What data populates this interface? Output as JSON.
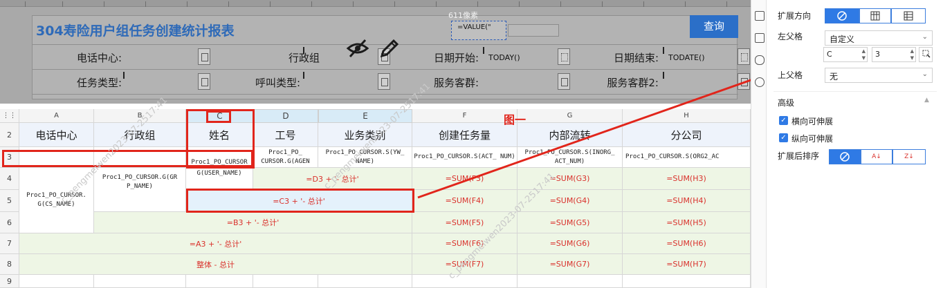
{
  "report": {
    "title": "304寿险用户组任务创建统计报表",
    "pixel_label": "611像素",
    "value_formula": "=VALUE(\"",
    "query_button": "查询",
    "fields": {
      "call_center": "电话中心:",
      "admin_group": "行政组",
      "date_start": "日期开始:",
      "date_start_value": "TODAY()",
      "date_end": "日期结束:",
      "date_end_value": "TODATE()",
      "task_type": "任务类型:",
      "call_type": "呼叫类型:",
      "service_group": "服务客群:",
      "service_group2": "服务客群2:"
    }
  },
  "sheet": {
    "columns": [
      "A",
      "B",
      "C",
      "D",
      "E",
      "F",
      "G",
      "H"
    ],
    "rows": [
      "2",
      "3",
      "4",
      "5",
      "6",
      "7",
      "8",
      "9"
    ],
    "headers": [
      "电话中心",
      "行政组",
      "姓名",
      "工号",
      "业务类别",
      "创建任务量",
      "内部流转",
      "分公司"
    ],
    "row3": {
      "C": "Proc1_PO_CURSOR",
      "D": "Proc1_PO_ CURSOR.G(AGEN",
      "E": "Proc1_PO_CURSOR.S(YW_ NAME)",
      "F": "Proc1_PO_CURSOR.S(ACT_ NUM)",
      "G": "Proc1_PO_CURSOR.S(INORG_ ACT_NUM)",
      "H": "Proc1_PO_CURSOR.S(ORG2_AC"
    },
    "A4": "Proc1_PO_CURSOR. G(CS_NAME)",
    "B4": "Proc1_PO_CURSOR.G(GR P_NAME)",
    "C4": "G(USER_NAME)",
    "D4": "=D3 + '- 总计'",
    "C5": "=C3 + '- 总计'",
    "B6": "=B3 + '- 总计'",
    "A7": "=A3 + '- 总计'",
    "A8": "整体 - 总计",
    "sums": {
      "r4": [
        "=SUM(F3)",
        "=SUM(G3)",
        "=SUM(H3)"
      ],
      "r5": [
        "=SUM(F4)",
        "=SUM(G4)",
        "=SUM(H4)"
      ],
      "r6": [
        "=SUM(F5)",
        "=SUM(G5)",
        "=SUM(H5)"
      ],
      "r7": [
        "=SUM(F6)",
        "=SUM(G6)",
        "=SUM(H6)"
      ],
      "r8": [
        "=SUM(F7)",
        "=SUM(G7)",
        "=SUM(H7)"
      ]
    },
    "annotation": "图一"
  },
  "panel": {
    "expand_direction": "扩展方向",
    "left_parent": "左父格",
    "left_parent_value": "自定义",
    "col_value": "C",
    "row_value": "3",
    "top_parent": "上父格",
    "top_parent_value": "无",
    "advanced": "高级",
    "horizontal_expand": "横向可伸展",
    "vertical_expand": "纵向可伸展",
    "sort_after_expand": "扩展后排序"
  },
  "watermark": "c_pengmeiwen2023-07-2517:41",
  "colors": {
    "accent": "#2f7ae5",
    "highlight": "#e1251b",
    "title": "#2e6ab8"
  }
}
